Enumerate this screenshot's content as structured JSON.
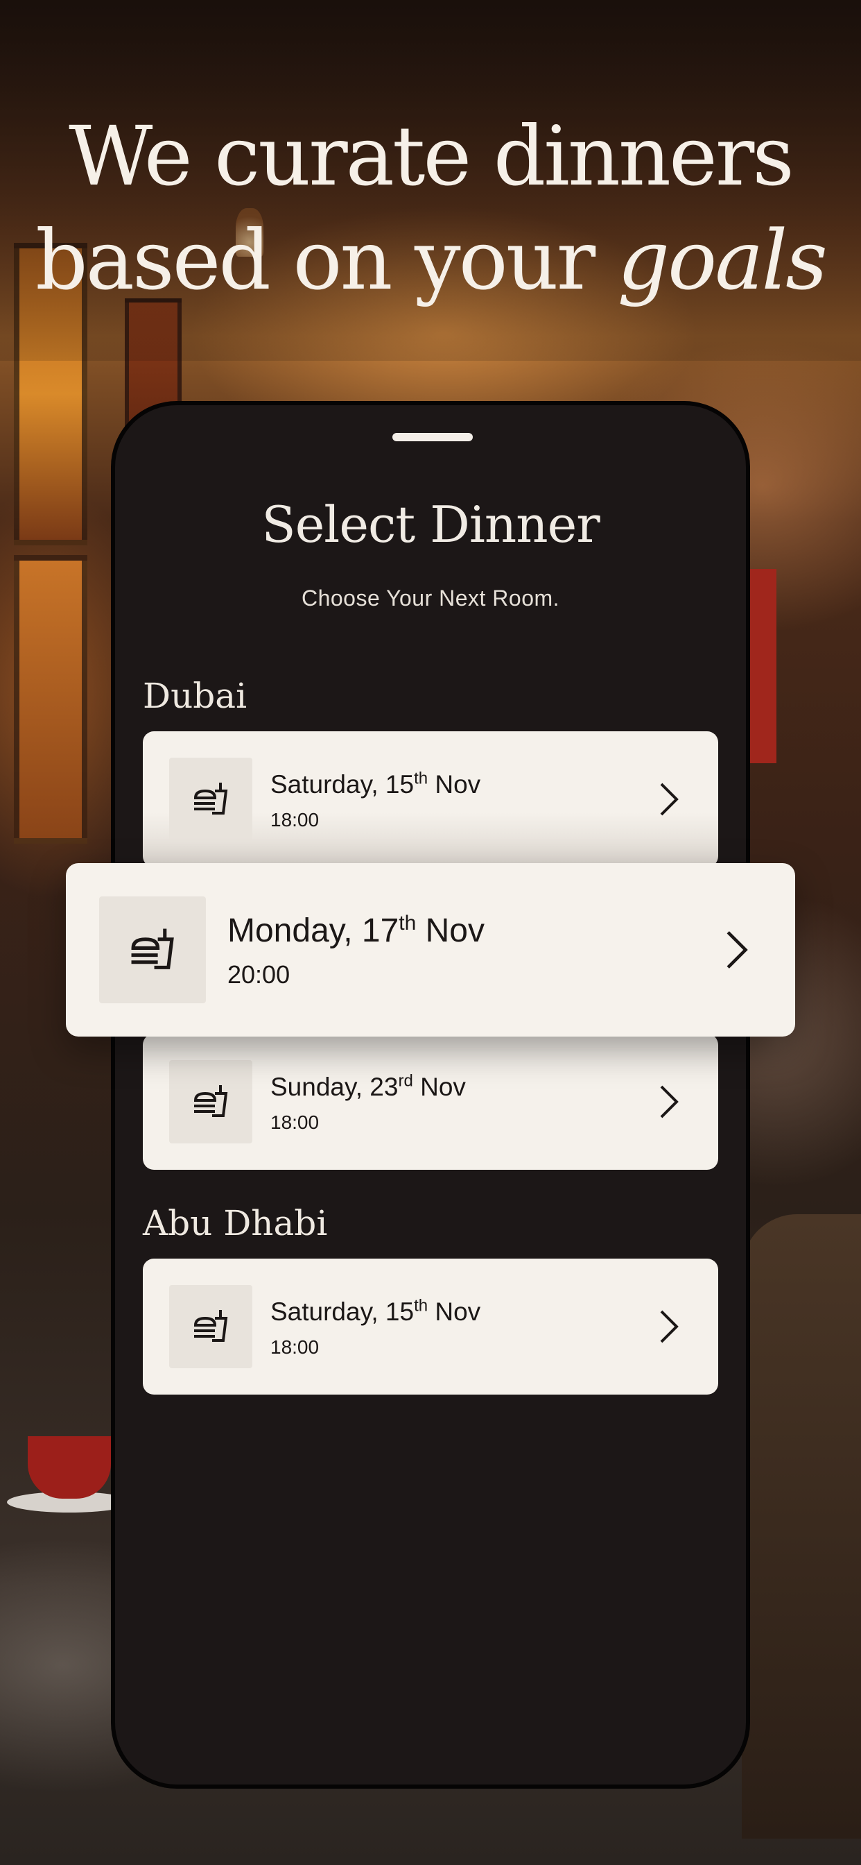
{
  "headline": {
    "line1": "We curate dinners",
    "line2_plain": "based on your",
    "line2_emphasis": "goals"
  },
  "sheet": {
    "title": "Select Dinner",
    "subtitle": "Choose Your Next Room."
  },
  "sections": [
    {
      "name": "Dubai",
      "dinners": [
        {
          "day": "Saturday, 15",
          "suffix": "th",
          "month": "Nov",
          "time": "18:00"
        },
        {
          "day": "Monday, 17",
          "suffix": "th",
          "month": "Nov",
          "time": "20:00",
          "highlighted": true
        },
        {
          "day": "Sunday, 23",
          "suffix": "rd",
          "month": "Nov",
          "time": "18:00"
        }
      ]
    },
    {
      "name": "Abu Dhabi",
      "dinners": [
        {
          "day": "Saturday, 15",
          "suffix": "th",
          "month": "Nov",
          "time": "18:00"
        }
      ]
    }
  ],
  "icons": {
    "dinner": "burger-drink-icon",
    "chevron": "chevron-right-icon"
  },
  "colors": {
    "sheet_bg": "#1c1717",
    "card_bg": "#f5f1eb",
    "text_light": "#f6f0e8"
  }
}
